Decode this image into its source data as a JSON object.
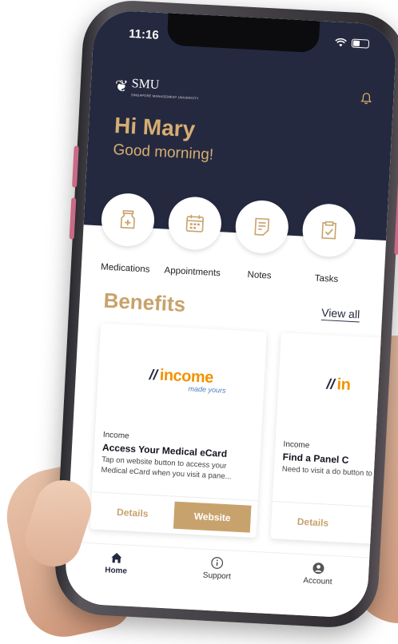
{
  "status_bar": {
    "time": "11:16"
  },
  "brand": {
    "logo_text": "SMU",
    "logo_subtext": "SINGAPORE MANAGEMENT UNIVERSITY"
  },
  "greeting": {
    "name": "Hi Mary",
    "message": "Good morning!"
  },
  "shortcuts": [
    {
      "label": "Medications",
      "icon": "medicine-bottle-icon"
    },
    {
      "label": "Appointments",
      "icon": "calendar-icon"
    },
    {
      "label": "Notes",
      "icon": "note-icon"
    },
    {
      "label": "Tasks",
      "icon": "clipboard-check-icon"
    }
  ],
  "benefits": {
    "title": "Benefits",
    "view_all": "View all",
    "cards": [
      {
        "logo": "income",
        "logo_tagline": "made yours",
        "provider": "Income",
        "title": "Access Your Medical eCard",
        "description": "Tap on website button to access your Medical eCard when you visit a pane...",
        "details_label": "Details",
        "website_label": "Website"
      },
      {
        "logo": "in",
        "provider": "Income",
        "title": "Find a Panel C",
        "description": "Need to visit a do button to locate a",
        "details_label": "Details"
      }
    ]
  },
  "tabbar": [
    {
      "label": "Home",
      "icon": "home-icon",
      "active": true
    },
    {
      "label": "Support",
      "icon": "info-icon",
      "active": false
    },
    {
      "label": "Account",
      "icon": "user-icon",
      "active": false
    }
  ],
  "colors": {
    "header_bg": "#25293f",
    "accent_gold": "#c8a26c",
    "income_orange": "#f39200"
  }
}
